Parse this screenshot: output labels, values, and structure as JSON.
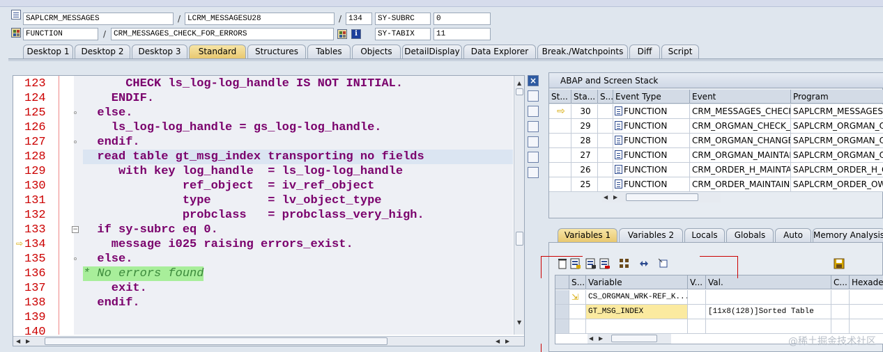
{
  "info": {
    "program": "SAPLCRM_MESSAGES",
    "include": "LCRM_MESSAGESU28",
    "line": "134",
    "sysvar1_name": "SY-SUBRC",
    "sysvar1_value": "0",
    "type": "FUNCTION",
    "name": "CRM_MESSAGES_CHECK_FOR_ERRORS",
    "sysvar2_name": "SY-TABIX",
    "sysvar2_value": "11",
    "sep": "/"
  },
  "tabs": [
    "Desktop 1",
    "Desktop 2",
    "Desktop 3",
    "Standard",
    "Structures",
    "Tables",
    "Objects",
    "DetailDisplay",
    "Data Explorer",
    "Break./Watchpoints",
    "Diff",
    "Script"
  ],
  "active_tab": "Standard",
  "code": [
    {
      "no": "123",
      "text": "      CHECK ls_log-log_handle IS NOT INITIAL."
    },
    {
      "no": "124",
      "text": "    ENDIF."
    },
    {
      "no": "125",
      "text": "  else."
    },
    {
      "no": "126",
      "text": "    ls_log-log_handle = gs_log-log_handle."
    },
    {
      "no": "127",
      "text": "  endif."
    },
    {
      "no": "128",
      "text": "  read table gt_msg_index transporting no fields"
    },
    {
      "no": "129",
      "text": "     with key log_handle  = ls_log-log_handle"
    },
    {
      "no": "130",
      "text": "              ref_object  = iv_ref_object"
    },
    {
      "no": "131",
      "text": "              type        = lv_object_type"
    },
    {
      "no": "132",
      "text": "              probclass   = probclass_very_high."
    },
    {
      "no": "133",
      "text": "  if sy-subrc eq 0."
    },
    {
      "no": "134",
      "text": "    message i025 raising errors_exist."
    },
    {
      "no": "135",
      "text": "  else."
    },
    {
      "no": "136",
      "text": "* No errors found"
    },
    {
      "no": "137",
      "text": "    exit."
    },
    {
      "no": "138",
      "text": "  endif."
    },
    {
      "no": "139",
      "text": ""
    },
    {
      "no": "140",
      "text": ""
    }
  ],
  "stack": {
    "title": "ABAP and Screen Stack",
    "headers": [
      "St...",
      "Sta...",
      "S...",
      "Event Type",
      "Event",
      "Program"
    ],
    "rows": [
      {
        "level": "30",
        "type": "FUNCTION",
        "event": "CRM_MESSAGES_CHECK...",
        "program": "SAPLCRM_MESSAGES"
      },
      {
        "level": "29",
        "type": "FUNCTION",
        "event": "CRM_ORGMAN_CHECK_O...",
        "program": "SAPLCRM_ORGMAN_OW"
      },
      {
        "level": "28",
        "type": "FUNCTION",
        "event": "CRM_ORGMAN_CHANGE...",
        "program": "SAPLCRM_ORGMAN_OW"
      },
      {
        "level": "27",
        "type": "FUNCTION",
        "event": "CRM_ORGMAN_MAINTAI...",
        "program": "SAPLCRM_ORGMAN_OW"
      },
      {
        "level": "26",
        "type": "FUNCTION",
        "event": "CRM_ORDER_H_MAINTA...",
        "program": "SAPLCRM_ORDER_H_OW"
      },
      {
        "level": "25",
        "type": "FUNCTION",
        "event": "CRM_ORDER_MAINTAIN...",
        "program": "SAPLCRM_ORDER_OW"
      }
    ]
  },
  "var_tabs": [
    "Variables 1",
    "Variables 2",
    "Locals",
    "Globals",
    "Auto",
    "Memory Analysis"
  ],
  "var_active": "Variables 1",
  "variables": {
    "headers": [
      "S...",
      "Variable",
      "V...",
      "Val.",
      "C...",
      "Hexadec"
    ],
    "rows": [
      {
        "name": "CS_ORGMAN_WRK-REF_K...",
        "value": ""
      },
      {
        "name": "GT_MSG_INDEX",
        "value": "[11x8(128)]Sorted Table"
      }
    ]
  },
  "watermark": "@稀土掘金技术社区",
  "colors": {
    "active_tab": "#e8c870",
    "keyword": "#7a006c",
    "comment_bg": "#a8ee9a",
    "line_no": "#cc0000"
  }
}
